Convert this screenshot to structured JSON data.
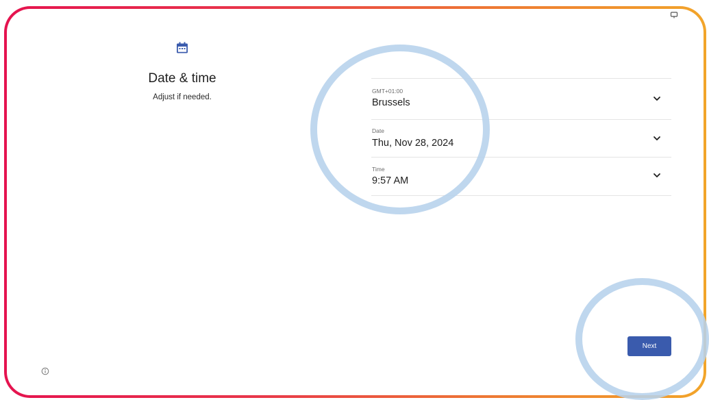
{
  "page": {
    "title": "Date & time",
    "subtitle": "Adjust if needed."
  },
  "settings": {
    "rows": [
      {
        "caption": "GMT+01:00",
        "value": "Brussels"
      },
      {
        "caption": "Date",
        "value": "Thu, Nov 28, 2024"
      },
      {
        "caption": "Time",
        "value": "9:57 AM"
      }
    ]
  },
  "footer": {
    "next_label": "Next"
  },
  "icons": {
    "calendar": "calendar-icon",
    "chevron": "chevron-down-icon",
    "status": "screen-icon",
    "info": "info-icon"
  },
  "colors": {
    "accent": "#3a5bad",
    "highlight_ring": "#b6d2ec",
    "frame_gradient_start": "#e5134f",
    "frame_gradient_end": "#f2a52a"
  }
}
